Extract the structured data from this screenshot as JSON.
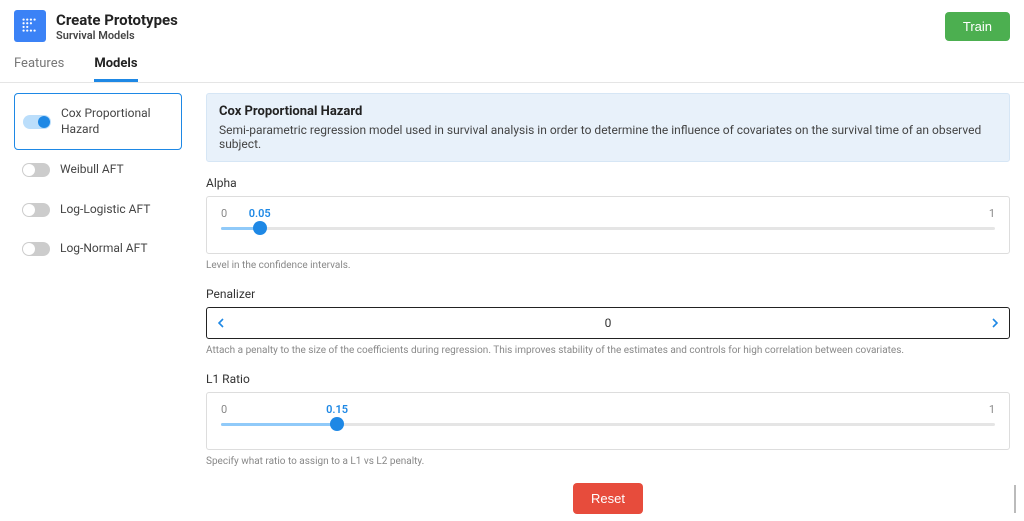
{
  "header": {
    "title": "Create Prototypes",
    "subtitle": "Survival Models",
    "train_label": "Train"
  },
  "tabs": {
    "features": "Features",
    "models": "Models"
  },
  "sidebar": {
    "items": [
      {
        "label": "Cox Proportional Hazard",
        "on": true,
        "selected": true
      },
      {
        "label": "Weibull AFT",
        "on": false,
        "selected": false
      },
      {
        "label": "Log-Logistic AFT",
        "on": false,
        "selected": false
      },
      {
        "label": "Log-Normal AFT",
        "on": false,
        "selected": false
      }
    ]
  },
  "info": {
    "title": "Cox Proportional Hazard",
    "description": "Semi-parametric regression model used in survival analysis in order to determine the influence of covariates on the survival time of an observed subject."
  },
  "params": {
    "alpha": {
      "label": "Alpha",
      "min": "0",
      "max": "1",
      "value_text": "0.05",
      "percent": 5,
      "help": "Level in the confidence intervals."
    },
    "penalizer": {
      "label": "Penalizer",
      "value_text": "0",
      "help": "Attach a penalty to the size of the coefficients during regression. This improves stability of the estimates and controls for high correlation between covariates."
    },
    "l1ratio": {
      "label": "L1 Ratio",
      "min": "0",
      "max": "1",
      "value_text": "0.15",
      "percent": 15,
      "help": "Specify what ratio to assign to a L1 vs L2 penalty."
    }
  },
  "reset_label": "Reset"
}
